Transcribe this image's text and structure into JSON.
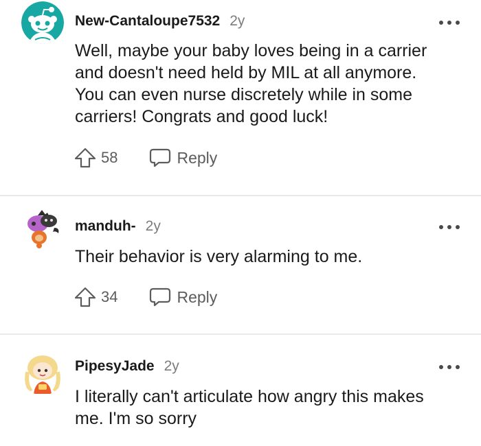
{
  "comments": [
    {
      "username": "New-Cantaloupe7532",
      "age": "2y",
      "avatar_icon": "snoo-avatar-teal",
      "body": "Well, maybe your baby loves being in a carrier\nand doesn't need held by MIL at all anymore.\nYou can even nurse discretely while in some\ncarriers! Congrats and good luck!",
      "upvotes": "58",
      "reply_label": "Reply"
    },
    {
      "username": "manduh-",
      "age": "2y",
      "avatar_icon": "snoo-avatar-purple-cat",
      "body": "Their behavior is very alarming to me.",
      "upvotes": "34",
      "reply_label": "Reply"
    },
    {
      "username": "PipesyJade",
      "age": "2y",
      "avatar_icon": "snoo-avatar-blonde",
      "body": "I literally can't articulate how angry this makes\nme. I'm so sorry"
    }
  ],
  "icons": {
    "upvote": "upvote-arrow-icon",
    "reply": "speech-bubble-icon",
    "more": "more-dots-icon"
  },
  "colors": {
    "text": "#1a1a1b",
    "meta": "#7c7c7c",
    "action": "#5c5c5c",
    "divider": "#e9e9e9",
    "teal_avatar": "#17a8a3"
  }
}
